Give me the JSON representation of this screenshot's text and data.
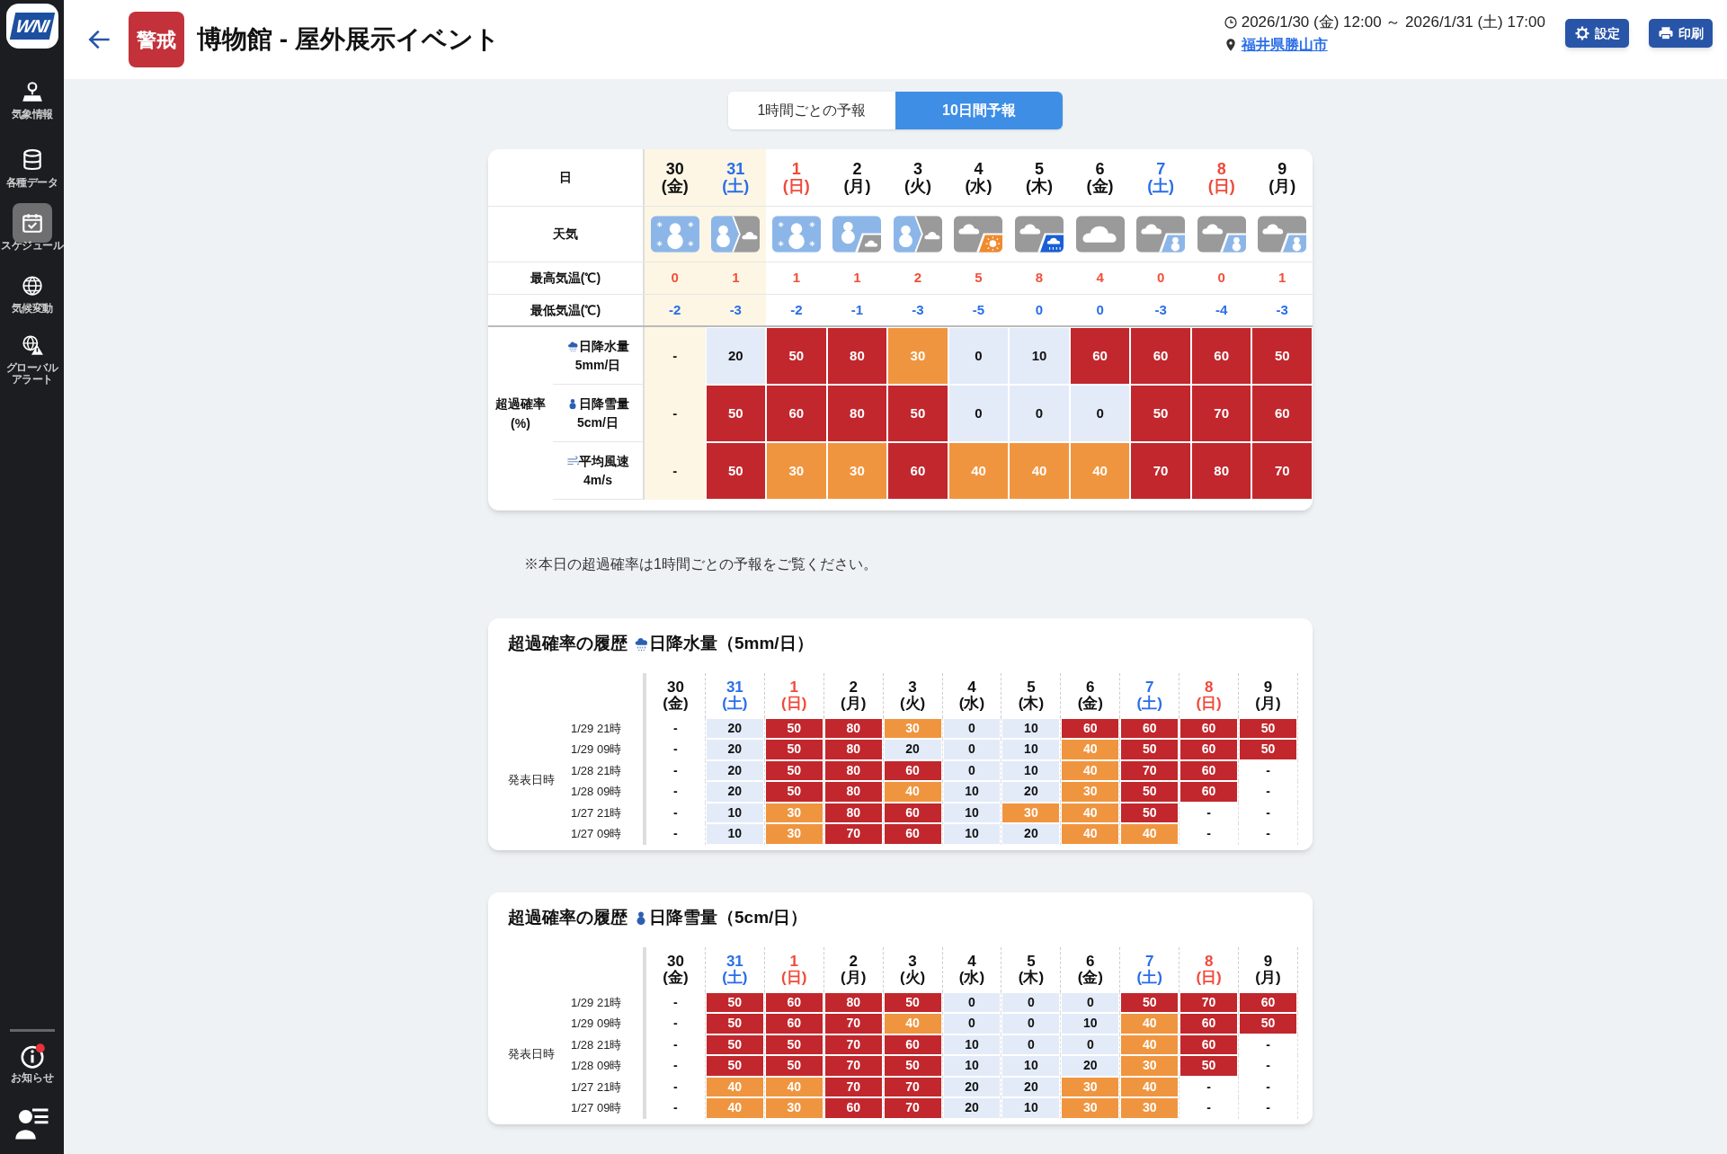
{
  "sidebar": {
    "logo": "WNI",
    "items": [
      {
        "label": "気象情報",
        "kind": "map",
        "selected": false
      },
      {
        "label": "各種データ",
        "kind": "data",
        "selected": false
      },
      {
        "label": "スケジュール",
        "kind": "schedule",
        "selected": true
      },
      {
        "label": "気候変動",
        "kind": "globe",
        "selected": false
      },
      {
        "label": "グローバルアラート",
        "kind": "alert",
        "selected": false
      }
    ],
    "notice": {
      "label": "お知らせ",
      "unread": true
    }
  },
  "header": {
    "badge": "警戒",
    "title": "博物館 - 屋外展示イベント",
    "period": "2026/1/30 (金) 12:00 ～ 2026/1/31 (土) 17:00",
    "location": "福井県勝山市",
    "buttons": [
      {
        "label": "設定",
        "kind": "settings"
      },
      {
        "label": "印刷",
        "kind": "print"
      }
    ]
  },
  "tabs": [
    {
      "label": "1時間ごとの予報",
      "selected": false
    },
    {
      "label": "10日間予報",
      "selected": true
    }
  ],
  "forecast": {
    "day_header": "日",
    "weather_header": "天気",
    "high_header": "最高気温(℃)",
    "low_header": "最低気温(℃)",
    "prob_header": "超過確率 (%)",
    "days": [
      {
        "date": "30",
        "dow": "(金)",
        "kind": "weekday",
        "in_period": true,
        "weather": {
          "kind": "snow"
        },
        "high": "0",
        "low": "-2"
      },
      {
        "date": "31",
        "dow": "(土)",
        "kind": "saturday",
        "in_period": true,
        "weather": {
          "kind": "snow_then_cloud"
        },
        "high": "1",
        "low": "-3"
      },
      {
        "date": "1",
        "dow": "(日)",
        "kind": "sunday",
        "in_period": false,
        "weather": {
          "kind": "snow"
        },
        "high": "1",
        "low": "-2"
      },
      {
        "date": "2",
        "dow": "(月)",
        "kind": "weekday",
        "in_period": false,
        "weather": {
          "kind": "snow_sometimes_cloud"
        },
        "high": "1",
        "low": "-1"
      },
      {
        "date": "3",
        "dow": "(火)",
        "kind": "weekday",
        "in_period": false,
        "weather": {
          "kind": "snow_then_cloud"
        },
        "high": "2",
        "low": "-3"
      },
      {
        "date": "4",
        "dow": "(水)",
        "kind": "weekday",
        "in_period": false,
        "weather": {
          "kind": "cloud_sometimes_sun"
        },
        "high": "5",
        "low": "-5"
      },
      {
        "date": "5",
        "dow": "(木)",
        "kind": "weekday",
        "in_period": false,
        "weather": {
          "kind": "cloud_sometimes_rain"
        },
        "high": "8",
        "low": "0"
      },
      {
        "date": "6",
        "dow": "(金)",
        "kind": "weekday",
        "in_period": false,
        "weather": {
          "kind": "cloud"
        },
        "high": "4",
        "low": "0"
      },
      {
        "date": "7",
        "dow": "(土)",
        "kind": "saturday",
        "in_period": false,
        "weather": {
          "kind": "cloud_sometimes_snow"
        },
        "high": "0",
        "low": "-3"
      },
      {
        "date": "8",
        "dow": "(日)",
        "kind": "sunday",
        "in_period": false,
        "weather": {
          "kind": "cloud_sometimes_snow"
        },
        "high": "0",
        "low": "-4"
      },
      {
        "date": "9",
        "dow": "(月)",
        "kind": "weekday",
        "in_period": false,
        "weather": {
          "kind": "cloud_sometimes_snow"
        },
        "high": "1",
        "low": "-3"
      }
    ],
    "prob_rows": [
      {
        "kind": "rain",
        "name": "日降水量",
        "threshold": "5mm/日",
        "cells": [
          {
            "t": "-",
            "kind": "none"
          },
          {
            "t": "20",
            "kind": "low"
          },
          {
            "t": "50",
            "kind": "high"
          },
          {
            "t": "80",
            "kind": "high"
          },
          {
            "t": "30",
            "kind": "mid"
          },
          {
            "t": "0",
            "kind": "low"
          },
          {
            "t": "10",
            "kind": "low"
          },
          {
            "t": "60",
            "kind": "high"
          },
          {
            "t": "60",
            "kind": "high"
          },
          {
            "t": "60",
            "kind": "high"
          },
          {
            "t": "50",
            "kind": "high"
          }
        ]
      },
      {
        "kind": "snow",
        "name": "日降雪量",
        "threshold": "5cm/日",
        "cells": [
          {
            "t": "-",
            "kind": "none"
          },
          {
            "t": "50",
            "kind": "high"
          },
          {
            "t": "60",
            "kind": "high"
          },
          {
            "t": "80",
            "kind": "high"
          },
          {
            "t": "50",
            "kind": "high"
          },
          {
            "t": "0",
            "kind": "low"
          },
          {
            "t": "0",
            "kind": "low"
          },
          {
            "t": "0",
            "kind": "low"
          },
          {
            "t": "50",
            "kind": "high"
          },
          {
            "t": "70",
            "kind": "high"
          },
          {
            "t": "60",
            "kind": "high"
          }
        ]
      },
      {
        "kind": "wind",
        "name": "平均風速",
        "threshold": "4m/s",
        "cells": [
          {
            "t": "-",
            "kind": "none"
          },
          {
            "t": "50",
            "kind": "high"
          },
          {
            "t": "30",
            "kind": "mid"
          },
          {
            "t": "30",
            "kind": "mid"
          },
          {
            "t": "60",
            "kind": "high"
          },
          {
            "t": "40",
            "kind": "mid"
          },
          {
            "t": "40",
            "kind": "mid"
          },
          {
            "t": "40",
            "kind": "mid"
          },
          {
            "t": "70",
            "kind": "high"
          },
          {
            "t": "80",
            "kind": "high"
          },
          {
            "t": "70",
            "kind": "high"
          }
        ]
      }
    ]
  },
  "note": "※本日の超過確率は1時間ごとの予報をご覧ください。",
  "history": [
    {
      "title": "超過確率の履歴",
      "kind": "rain",
      "metric": "日降水量（5mm/日）",
      "row_header": "発表日時",
      "days": [
        {
          "date": "30",
          "dow": "(金)",
          "kind": "weekday"
        },
        {
          "date": "31",
          "dow": "(土)",
          "kind": "saturday"
        },
        {
          "date": "1",
          "dow": "(日)",
          "kind": "sunday"
        },
        {
          "date": "2",
          "dow": "(月)",
          "kind": "weekday"
        },
        {
          "date": "3",
          "dow": "(火)",
          "kind": "weekday"
        },
        {
          "date": "4",
          "dow": "(水)",
          "kind": "weekday"
        },
        {
          "date": "5",
          "dow": "(木)",
          "kind": "weekday"
        },
        {
          "date": "6",
          "dow": "(金)",
          "kind": "weekday"
        },
        {
          "date": "7",
          "dow": "(土)",
          "kind": "saturday"
        },
        {
          "date": "8",
          "dow": "(日)",
          "kind": "sunday"
        },
        {
          "date": "9",
          "dow": "(月)",
          "kind": "weekday"
        }
      ],
      "rows": [
        {
          "label": "1/29 21時",
          "cells": [
            {
              "t": "-",
              "kind": "none"
            },
            {
              "t": "20",
              "kind": "low"
            },
            {
              "t": "50",
              "kind": "high"
            },
            {
              "t": "80",
              "kind": "high"
            },
            {
              "t": "30",
              "kind": "mid"
            },
            {
              "t": "0",
              "kind": "low"
            },
            {
              "t": "10",
              "kind": "low"
            },
            {
              "t": "60",
              "kind": "high"
            },
            {
              "t": "60",
              "kind": "high"
            },
            {
              "t": "60",
              "kind": "high"
            },
            {
              "t": "50",
              "kind": "high"
            }
          ]
        },
        {
          "label": "1/29 09時",
          "cells": [
            {
              "t": "-",
              "kind": "none"
            },
            {
              "t": "20",
              "kind": "low"
            },
            {
              "t": "50",
              "kind": "high"
            },
            {
              "t": "80",
              "kind": "high"
            },
            {
              "t": "20",
              "kind": "low"
            },
            {
              "t": "0",
              "kind": "low"
            },
            {
              "t": "10",
              "kind": "low"
            },
            {
              "t": "40",
              "kind": "mid"
            },
            {
              "t": "50",
              "kind": "high"
            },
            {
              "t": "60",
              "kind": "high"
            },
            {
              "t": "50",
              "kind": "high"
            }
          ]
        },
        {
          "label": "1/28 21時",
          "cells": [
            {
              "t": "-",
              "kind": "none"
            },
            {
              "t": "20",
              "kind": "low"
            },
            {
              "t": "50",
              "kind": "high"
            },
            {
              "t": "80",
              "kind": "high"
            },
            {
              "t": "60",
              "kind": "high"
            },
            {
              "t": "0",
              "kind": "low"
            },
            {
              "t": "10",
              "kind": "low"
            },
            {
              "t": "40",
              "kind": "mid"
            },
            {
              "t": "70",
              "kind": "high"
            },
            {
              "t": "60",
              "kind": "high"
            },
            {
              "t": "-",
              "kind": "none"
            }
          ]
        },
        {
          "label": "1/28 09時",
          "cells": [
            {
              "t": "-",
              "kind": "none"
            },
            {
              "t": "20",
              "kind": "low"
            },
            {
              "t": "50",
              "kind": "high"
            },
            {
              "t": "80",
              "kind": "high"
            },
            {
              "t": "40",
              "kind": "mid"
            },
            {
              "t": "10",
              "kind": "low"
            },
            {
              "t": "20",
              "kind": "low"
            },
            {
              "t": "30",
              "kind": "mid"
            },
            {
              "t": "50",
              "kind": "high"
            },
            {
              "t": "60",
              "kind": "high"
            },
            {
              "t": "-",
              "kind": "none"
            }
          ]
        },
        {
          "label": "1/27 21時",
          "cells": [
            {
              "t": "-",
              "kind": "none"
            },
            {
              "t": "10",
              "kind": "low"
            },
            {
              "t": "30",
              "kind": "mid"
            },
            {
              "t": "80",
              "kind": "high"
            },
            {
              "t": "60",
              "kind": "high"
            },
            {
              "t": "10",
              "kind": "low"
            },
            {
              "t": "30",
              "kind": "mid"
            },
            {
              "t": "40",
              "kind": "mid"
            },
            {
              "t": "50",
              "kind": "high"
            },
            {
              "t": "-",
              "kind": "none"
            },
            {
              "t": "-",
              "kind": "none"
            }
          ]
        },
        {
          "label": "1/27 09時",
          "cells": [
            {
              "t": "-",
              "kind": "none"
            },
            {
              "t": "10",
              "kind": "low"
            },
            {
              "t": "30",
              "kind": "mid"
            },
            {
              "t": "70",
              "kind": "high"
            },
            {
              "t": "60",
              "kind": "high"
            },
            {
              "t": "10",
              "kind": "low"
            },
            {
              "t": "20",
              "kind": "low"
            },
            {
              "t": "40",
              "kind": "mid"
            },
            {
              "t": "40",
              "kind": "mid"
            },
            {
              "t": "-",
              "kind": "none"
            },
            {
              "t": "-",
              "kind": "none"
            }
          ]
        }
      ]
    },
    {
      "title": "超過確率の履歴",
      "kind": "snow",
      "metric": "日降雪量（5cm/日）",
      "row_header": "発表日時",
      "days": [
        {
          "date": "30",
          "dow": "(金)",
          "kind": "weekday"
        },
        {
          "date": "31",
          "dow": "(土)",
          "kind": "saturday"
        },
        {
          "date": "1",
          "dow": "(日)",
          "kind": "sunday"
        },
        {
          "date": "2",
          "dow": "(月)",
          "kind": "weekday"
        },
        {
          "date": "3",
          "dow": "(火)",
          "kind": "weekday"
        },
        {
          "date": "4",
          "dow": "(水)",
          "kind": "weekday"
        },
        {
          "date": "5",
          "dow": "(木)",
          "kind": "weekday"
        },
        {
          "date": "6",
          "dow": "(金)",
          "kind": "weekday"
        },
        {
          "date": "7",
          "dow": "(土)",
          "kind": "saturday"
        },
        {
          "date": "8",
          "dow": "(日)",
          "kind": "sunday"
        },
        {
          "date": "9",
          "dow": "(月)",
          "kind": "weekday"
        }
      ],
      "rows": [
        {
          "label": "1/29 21時",
          "cells": [
            {
              "t": "-",
              "kind": "none"
            },
            {
              "t": "50",
              "kind": "high"
            },
            {
              "t": "60",
              "kind": "high"
            },
            {
              "t": "80",
              "kind": "high"
            },
            {
              "t": "50",
              "kind": "high"
            },
            {
              "t": "0",
              "kind": "low"
            },
            {
              "t": "0",
              "kind": "low"
            },
            {
              "t": "0",
              "kind": "low"
            },
            {
              "t": "50",
              "kind": "high"
            },
            {
              "t": "70",
              "kind": "high"
            },
            {
              "t": "60",
              "kind": "high"
            }
          ]
        },
        {
          "label": "1/29 09時",
          "cells": [
            {
              "t": "-",
              "kind": "none"
            },
            {
              "t": "50",
              "kind": "high"
            },
            {
              "t": "60",
              "kind": "high"
            },
            {
              "t": "70",
              "kind": "high"
            },
            {
              "t": "40",
              "kind": "mid"
            },
            {
              "t": "0",
              "kind": "low"
            },
            {
              "t": "0",
              "kind": "low"
            },
            {
              "t": "10",
              "kind": "low"
            },
            {
              "t": "40",
              "kind": "mid"
            },
            {
              "t": "60",
              "kind": "high"
            },
            {
              "t": "50",
              "kind": "high"
            }
          ]
        },
        {
          "label": "1/28 21時",
          "cells": [
            {
              "t": "-",
              "kind": "none"
            },
            {
              "t": "50",
              "kind": "high"
            },
            {
              "t": "50",
              "kind": "high"
            },
            {
              "t": "70",
              "kind": "high"
            },
            {
              "t": "60",
              "kind": "high"
            },
            {
              "t": "10",
              "kind": "low"
            },
            {
              "t": "0",
              "kind": "low"
            },
            {
              "t": "0",
              "kind": "low"
            },
            {
              "t": "40",
              "kind": "mid"
            },
            {
              "t": "60",
              "kind": "high"
            },
            {
              "t": "-",
              "kind": "none"
            }
          ]
        },
        {
          "label": "1/28 09時",
          "cells": [
            {
              "t": "-",
              "kind": "none"
            },
            {
              "t": "50",
              "kind": "high"
            },
            {
              "t": "50",
              "kind": "high"
            },
            {
              "t": "70",
              "kind": "high"
            },
            {
              "t": "50",
              "kind": "high"
            },
            {
              "t": "10",
              "kind": "low"
            },
            {
              "t": "10",
              "kind": "low"
            },
            {
              "t": "20",
              "kind": "low"
            },
            {
              "t": "30",
              "kind": "mid"
            },
            {
              "t": "50",
              "kind": "high"
            },
            {
              "t": "-",
              "kind": "none"
            }
          ]
        },
        {
          "label": "1/27 21時",
          "cells": [
            {
              "t": "-",
              "kind": "none"
            },
            {
              "t": "40",
              "kind": "mid"
            },
            {
              "t": "40",
              "kind": "mid"
            },
            {
              "t": "70",
              "kind": "high"
            },
            {
              "t": "70",
              "kind": "high"
            },
            {
              "t": "20",
              "kind": "low"
            },
            {
              "t": "20",
              "kind": "low"
            },
            {
              "t": "30",
              "kind": "mid"
            },
            {
              "t": "40",
              "kind": "mid"
            },
            {
              "t": "-",
              "kind": "none"
            },
            {
              "t": "-",
              "kind": "none"
            }
          ]
        },
        {
          "label": "1/27 09時",
          "cells": [
            {
              "t": "-",
              "kind": "none"
            },
            {
              "t": "40",
              "kind": "mid"
            },
            {
              "t": "30",
              "kind": "mid"
            },
            {
              "t": "60",
              "kind": "high"
            },
            {
              "t": "70",
              "kind": "high"
            },
            {
              "t": "20",
              "kind": "low"
            },
            {
              "t": "10",
              "kind": "low"
            },
            {
              "t": "30",
              "kind": "mid"
            },
            {
              "t": "30",
              "kind": "mid"
            },
            {
              "t": "-",
              "kind": "none"
            },
            {
              "t": "-",
              "kind": "none"
            }
          ]
        }
      ]
    }
  ]
}
